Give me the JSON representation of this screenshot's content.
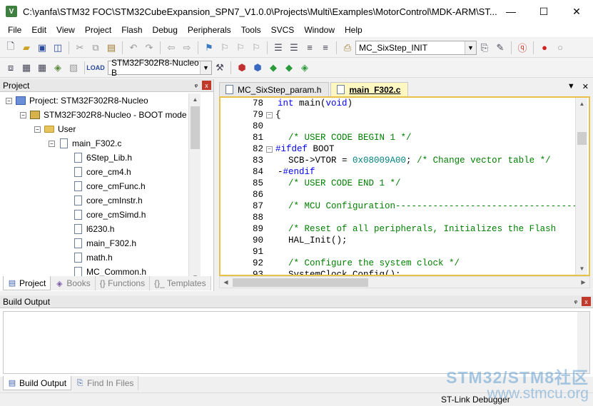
{
  "window": {
    "title": "C:\\yanfa\\STM32 FOC\\STM32CubeExpansion_SPN7_V1.0.0\\Projects\\Multi\\Examples\\MotorControl\\MDK-ARM\\ST...",
    "app_icon": "V",
    "controls": {
      "minimize": "—",
      "maximize": "☐",
      "close": "✕"
    }
  },
  "menu": [
    "File",
    "Edit",
    "View",
    "Project",
    "Flash",
    "Debug",
    "Peripherals",
    "Tools",
    "SVCS",
    "Window",
    "Help"
  ],
  "toolbar": {
    "function_combo": "MC_SixStep_INIT",
    "target_combo": "STM32F302R8-Nucleo - B"
  },
  "project_panel": {
    "title": "Project",
    "pin": "ᵩ",
    "close": "x",
    "tree": [
      {
        "label": "Project: STM32F302R8-Nucleo",
        "icon": "project-icon",
        "expander": "−"
      },
      {
        "label": "STM32F302R8-Nucleo - BOOT mode",
        "icon": "target-icon",
        "expander": "−"
      },
      {
        "label": "User",
        "icon": "folder-icon",
        "expander": "−"
      },
      {
        "label": "main_F302.c",
        "icon": "file-icon",
        "expander": "−"
      },
      {
        "label": "6Step_Lib.h",
        "icon": "file-icon"
      },
      {
        "label": "core_cm4.h",
        "icon": "file-icon"
      },
      {
        "label": "core_cmFunc.h",
        "icon": "file-icon"
      },
      {
        "label": "core_cmInstr.h",
        "icon": "file-icon"
      },
      {
        "label": "core_cmSimd.h",
        "icon": "file-icon"
      },
      {
        "label": "l6230.h",
        "icon": "file-icon"
      },
      {
        "label": "main_F302.h",
        "icon": "file-icon"
      },
      {
        "label": "math.h",
        "icon": "file-icon"
      },
      {
        "label": "MC_Common.h",
        "icon": "file-icon"
      }
    ],
    "tabs": [
      "Project",
      "Books",
      "{} Functions",
      "{}_ Templates"
    ]
  },
  "editor": {
    "tabs": [
      {
        "label": "MC_SixStep_param.h",
        "active": false
      },
      {
        "label": "main_F302.c",
        "active": true
      }
    ],
    "lines": [
      {
        "n": "78",
        "fold": "",
        "text": "int main(void)"
      },
      {
        "n": "79",
        "fold": "−",
        "text": "{"
      },
      {
        "n": "80",
        "fold": "",
        "text": ""
      },
      {
        "n": "81",
        "fold": "",
        "text": "  /* USER CODE BEGIN 1 */"
      },
      {
        "n": "82",
        "fold": "−",
        "text": "#ifdef BOOT"
      },
      {
        "n": "83",
        "fold": "",
        "text": "  SCB->VTOR = 0x08009A00; /* Change vector table */"
      },
      {
        "n": "84",
        "fold": "",
        "text": "-#endif"
      },
      {
        "n": "85",
        "fold": "",
        "text": "  /* USER CODE END 1 */"
      },
      {
        "n": "86",
        "fold": "",
        "text": ""
      },
      {
        "n": "87",
        "fold": "",
        "text": "  /* MCU Configuration----------------------------------"
      },
      {
        "n": "88",
        "fold": "",
        "text": ""
      },
      {
        "n": "89",
        "fold": "",
        "text": "  /* Reset of all peripherals, Initializes the Flash"
      },
      {
        "n": "90",
        "fold": "",
        "text": "  HAL_Init();"
      },
      {
        "n": "91",
        "fold": "",
        "text": ""
      },
      {
        "n": "92",
        "fold": "",
        "text": "  /* Configure the system clock */"
      },
      {
        "n": "93",
        "fold": "",
        "text": "  SystemClock_Config();"
      }
    ]
  },
  "build_output": {
    "title": "Build Output",
    "tabs": [
      "Build Output",
      "Find In Files"
    ]
  },
  "status": {
    "debugger": "ST-Link Debugger"
  },
  "watermark": {
    "line1": "STM32/STM8社区",
    "line2": "www.stmcu.org"
  },
  "colors": {
    "keyword": "#0000ff",
    "comment": "#008000",
    "number": "#008080",
    "active_tab": "#fff7c2",
    "editor_border": "#e7c14a"
  }
}
